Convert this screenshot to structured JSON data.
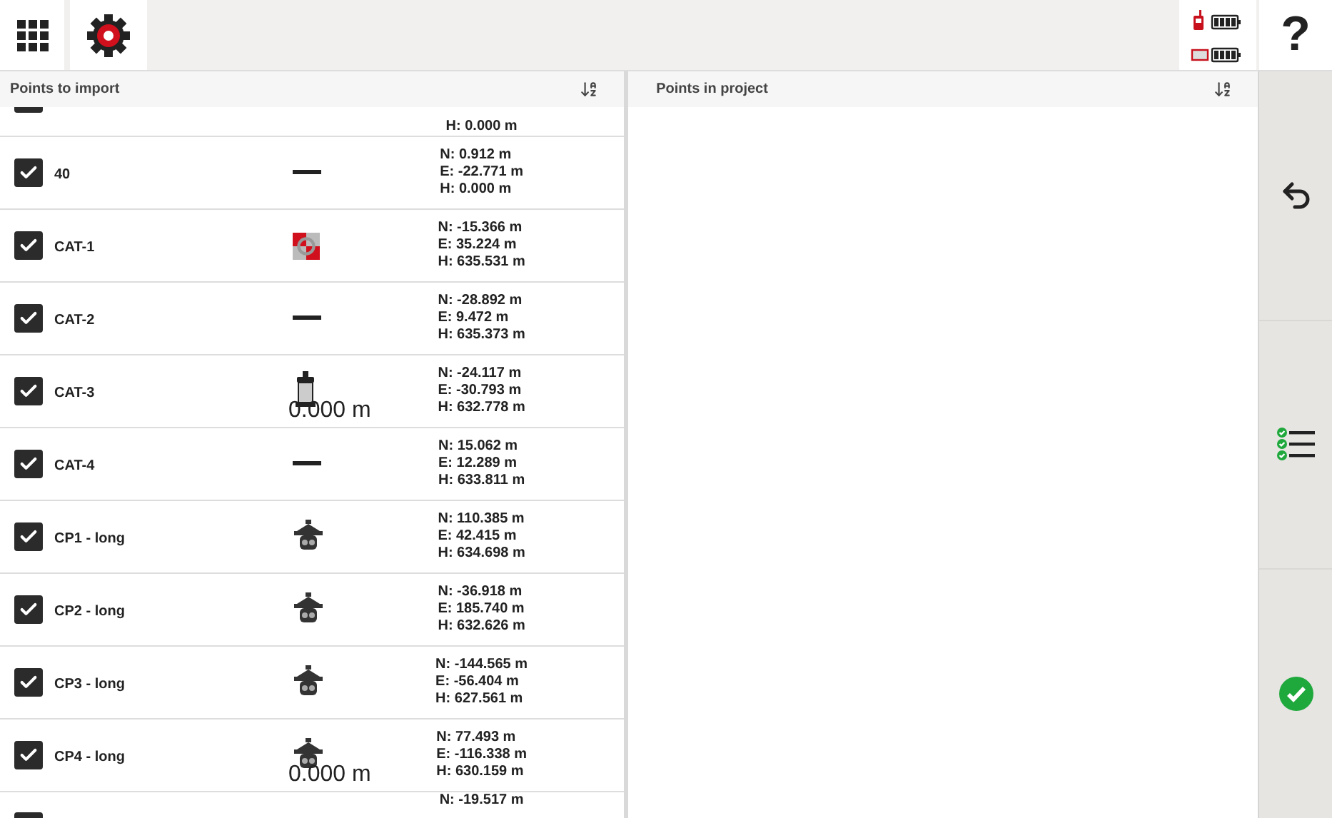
{
  "top_bar": {
    "help_label": "?"
  },
  "import_panel": {
    "title": "Points to import",
    "rows": [
      {
        "name": "",
        "checked": true,
        "kind": "partial_top",
        "coords": [
          "H: 0.000 m"
        ]
      },
      {
        "name": "40",
        "checked": true,
        "kind": "line",
        "coords": [
          "N: 0.912 m",
          "E: -22.771 m",
          "H: 0.000 m"
        ]
      },
      {
        "name": "CAT-1",
        "checked": true,
        "kind": "target",
        "coords": [
          "N: -15.366 m",
          "E: 35.224 m",
          "H: 635.531 m"
        ]
      },
      {
        "name": "CAT-2",
        "checked": true,
        "kind": "line",
        "coords": [
          "N: -28.892 m",
          "E: 9.472 m",
          "H: 635.373 m"
        ]
      },
      {
        "name": "CAT-3",
        "checked": true,
        "kind": "prism",
        "icon_label": "0.000 m",
        "coords": [
          "N: -24.117 m",
          "E: -30.793 m",
          "H: 632.778 m"
        ]
      },
      {
        "name": "CAT-4",
        "checked": true,
        "kind": "line",
        "coords": [
          "N: 15.062 m",
          "E: 12.289 m",
          "H: 633.811 m"
        ]
      },
      {
        "name": "CP1 - long",
        "checked": true,
        "kind": "lamp",
        "coords": [
          "N: 110.385 m",
          "E: 42.415 m",
          "H: 634.698 m"
        ]
      },
      {
        "name": "CP2 - long",
        "checked": true,
        "kind": "lamp",
        "coords": [
          "N: -36.918 m",
          "E: 185.740 m",
          "H: 632.626 m"
        ]
      },
      {
        "name": "CP3 - long",
        "checked": true,
        "kind": "lamp",
        "coords": [
          "N: -144.565 m",
          "E: -56.404 m",
          "H: 627.561 m"
        ]
      },
      {
        "name": "CP4 - long",
        "checked": true,
        "kind": "lamp",
        "icon_label": "0.000 m",
        "coords": [
          "N: 77.493 m",
          "E: -116.338 m",
          "H: 630.159 m"
        ]
      },
      {
        "name": "",
        "checked": true,
        "kind": "partial_bottom",
        "coords": [
          "N: -19.517 m"
        ]
      }
    ]
  },
  "project_panel": {
    "title": "Points in project"
  }
}
